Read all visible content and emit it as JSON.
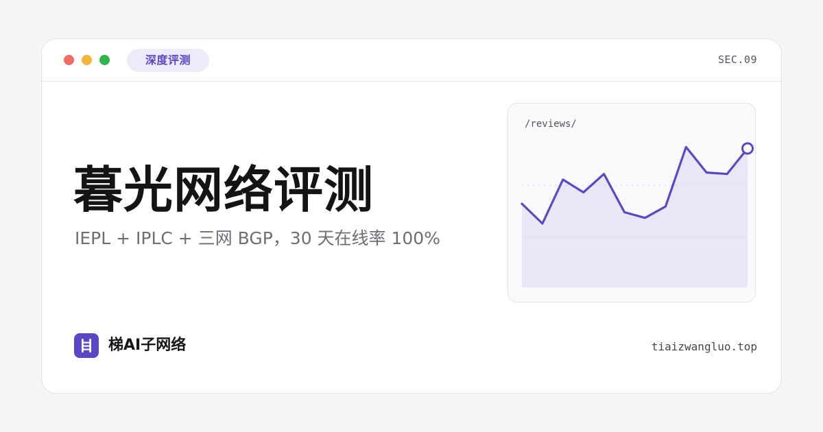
{
  "colors": {
    "accent": "#5b47c6",
    "pill_bg": "#ecebfa",
    "area_fill": "#e9e6f8",
    "dot_red": "#f26b64",
    "dot_yellow": "#f4b63a",
    "dot_green": "#2bb84a"
  },
  "window": {
    "badge": "深度评测",
    "section": "SEC.09"
  },
  "hero": {
    "title": "暮光网络评测",
    "subtitle": "IEPL + IPLC + 三网 BGP，30 天在线率 100%"
  },
  "preview": {
    "path_label": "/reviews/"
  },
  "chart_data": {
    "type": "area",
    "values": [
      0.59,
      0.45,
      0.76,
      0.67,
      0.8,
      0.53,
      0.49,
      0.57,
      0.99,
      0.81,
      0.8,
      0.98
    ],
    "ylim": [
      0,
      1.2
    ],
    "grid": true,
    "highlight_last_point": true
  },
  "footer": {
    "brand_icon": "ladder-icon",
    "brand_name": "梯AI子网络",
    "domain": "tiaizwangluo.top"
  }
}
